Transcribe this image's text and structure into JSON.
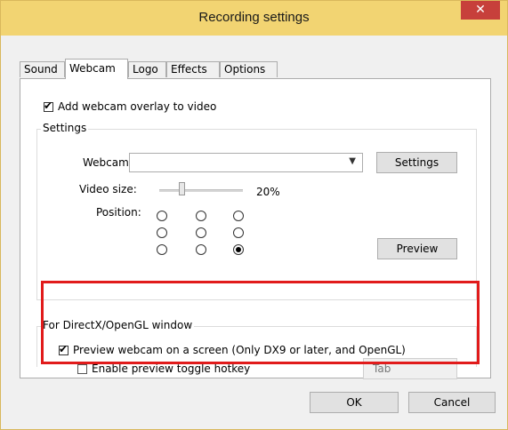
{
  "window": {
    "title": "Recording settings",
    "close_glyph": "✕"
  },
  "tabs": [
    {
      "label": "Sound",
      "active": false
    },
    {
      "label": "Webcam",
      "active": true
    },
    {
      "label": "Logo",
      "active": false
    },
    {
      "label": "Effects",
      "active": false
    },
    {
      "label": "Options",
      "active": false
    }
  ],
  "webcam_tab": {
    "overlay_checkbox": {
      "label": "Add webcam overlay to video",
      "checked": true
    },
    "settings_group": {
      "title": "Settings",
      "webcam_label": "Webcam:",
      "webcam_value": "",
      "settings_button": "Settings",
      "video_size_label": "Video size:",
      "video_size_value": "20%",
      "position_label": "Position:",
      "positions": [
        [
          false,
          false,
          false
        ],
        [
          false,
          false,
          false
        ],
        [
          false,
          false,
          true
        ]
      ],
      "preview_button": "Preview"
    },
    "directx_group": {
      "title": "For DirectX/OpenGL window",
      "preview_checkbox": {
        "label": "Preview webcam on a screen (Only DX9 or later, and OpenGL)",
        "checked": true
      },
      "hotkey_checkbox": {
        "label": "Enable preview toggle hotkey",
        "checked": false
      },
      "hotkey_value": "Tab"
    }
  },
  "footer": {
    "ok_label": "OK",
    "cancel_label": "Cancel"
  },
  "colors": {
    "titlebar": "#f2d472",
    "close": "#c7403b",
    "highlight": "#e11b1b"
  },
  "icons": {
    "close": "close-icon",
    "check": "check-icon",
    "dropdown": "chevron-down-icon"
  }
}
